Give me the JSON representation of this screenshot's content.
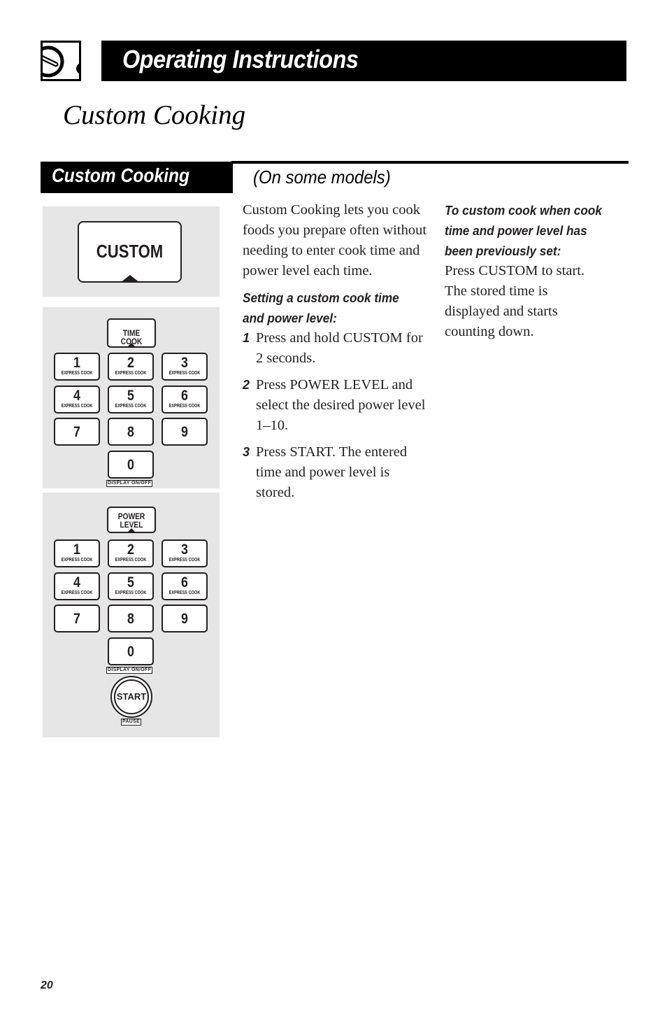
{
  "header": {
    "title": "Operating Instructions",
    "logo_icon": "knob-dial-icon"
  },
  "page_title": "Custom Cooking",
  "section": {
    "title": "Custom Cooking",
    "subtitle": "(On some models)"
  },
  "illustrations": {
    "custom_key": {
      "label": "CUSTOM"
    },
    "time_cook_panel": {
      "function_key": "TIME COOK",
      "number_keys": [
        {
          "num": "1",
          "sub": "EXPRESS COOK"
        },
        {
          "num": "2",
          "sub": "EXPRESS COOK"
        },
        {
          "num": "3",
          "sub": "EXPRESS COOK"
        },
        {
          "num": "4",
          "sub": "EXPRESS COOK"
        },
        {
          "num": "5",
          "sub": "EXPRESS COOK"
        },
        {
          "num": "6",
          "sub": "EXPRESS COOK"
        },
        {
          "num": "7",
          "sub": ""
        },
        {
          "num": "8",
          "sub": ""
        },
        {
          "num": "9",
          "sub": ""
        },
        {
          "num": "0",
          "sub": ""
        }
      ],
      "zero_tag": "DISPLAY ON/OFF"
    },
    "power_panel": {
      "function_key_line1": "POWER",
      "function_key_line2": "LEVEL",
      "number_keys": [
        {
          "num": "1",
          "sub": "EXPRESS COOK"
        },
        {
          "num": "2",
          "sub": "EXPRESS COOK"
        },
        {
          "num": "3",
          "sub": "EXPRESS COOK"
        },
        {
          "num": "4",
          "sub": "EXPRESS COOK"
        },
        {
          "num": "5",
          "sub": "EXPRESS COOK"
        },
        {
          "num": "6",
          "sub": "EXPRESS COOK"
        },
        {
          "num": "7",
          "sub": ""
        },
        {
          "num": "8",
          "sub": ""
        },
        {
          "num": "9",
          "sub": ""
        },
        {
          "num": "0",
          "sub": ""
        }
      ],
      "zero_tag": "DISPLAY ON/OFF",
      "start_label": "START",
      "start_tag": "PAUSE"
    }
  },
  "body": {
    "intro": "Custom Cooking lets you cook foods you prepare often without needing to enter cook time and power level each time.",
    "setting_heading_line1": "Setting a custom cook time",
    "setting_heading_line2": "and power level:",
    "steps": [
      {
        "num": "1",
        "text": "Press and hold CUSTOM for 2 seconds."
      },
      {
        "num": "2",
        "text": "Press POWER LEVEL and select the desired power level 1–10."
      },
      {
        "num": "3",
        "text": "Press START. The entered time and power level is stored."
      }
    ],
    "previously_set_heading_line1": "To custom cook when cook",
    "previously_set_heading_line2": "time and power level has",
    "previously_set_heading_line3": "been previously set:",
    "previously_set_text": "Press CUSTOM to start. The stored time is displayed and starts counting down."
  },
  "page_number": "20"
}
